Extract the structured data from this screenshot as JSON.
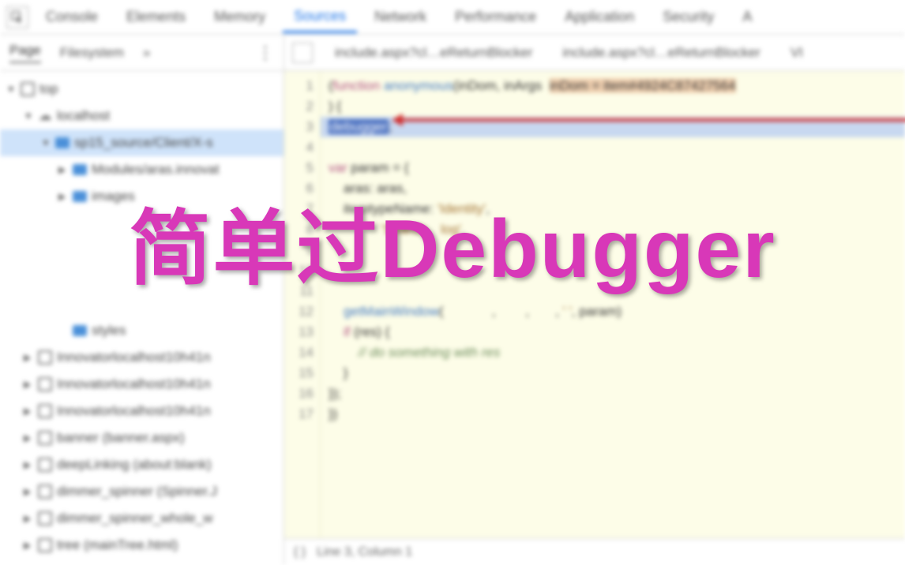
{
  "overlay": {
    "title": "简单过Debugger"
  },
  "toptabs": {
    "items": [
      "Console",
      "Elements",
      "Memory",
      "Sources",
      "Network",
      "Performance",
      "Application",
      "Security",
      "A"
    ],
    "active": 3
  },
  "sidebar": {
    "tabs": {
      "page": "Page",
      "fs": "Filesystem",
      "more": "»"
    },
    "tree": [
      {
        "d": 0,
        "arr": "▼",
        "ico": "frame",
        "txt": "top"
      },
      {
        "d": 1,
        "arr": "▼",
        "ico": "cloud",
        "txt": "localhost"
      },
      {
        "d": 2,
        "arr": "▼",
        "ico": "folder",
        "txt": "sp15_source/Client/X-s",
        "sel": true
      },
      {
        "d": 3,
        "arr": "▶",
        "ico": "folder",
        "txt": "Modules/aras.innovat"
      },
      {
        "d": 3,
        "arr": "▶",
        "ico": "folder",
        "txt": "images"
      },
      {
        "d": 3,
        "arr": "",
        "ico": "",
        "txt": ""
      },
      {
        "d": 3,
        "arr": "",
        "ico": "",
        "txt": ""
      },
      {
        "d": 3,
        "arr": "",
        "ico": "",
        "txt": ""
      },
      {
        "d": 3,
        "arr": "",
        "ico": "",
        "txt": ""
      },
      {
        "d": 3,
        "arr": "",
        "ico": "folder",
        "txt": "styles"
      },
      {
        "d": 1,
        "arr": "▶",
        "ico": "frame",
        "txt": "Innovatorlocalhost10h41n"
      },
      {
        "d": 1,
        "arr": "▶",
        "ico": "frame",
        "txt": "Innovatorlocalhost10h41n"
      },
      {
        "d": 1,
        "arr": "▶",
        "ico": "frame",
        "txt": "Innovatorlocalhost10h41n"
      },
      {
        "d": 1,
        "arr": "▶",
        "ico": "frame",
        "txt": "banner (banner.aspx)"
      },
      {
        "d": 1,
        "arr": "▶",
        "ico": "frame",
        "txt": "deepLinking (about:blank)"
      },
      {
        "d": 1,
        "arr": "▶",
        "ico": "frame",
        "txt": "dimmer_spinner (Spinner.J"
      },
      {
        "d": 1,
        "arr": "▶",
        "ico": "frame",
        "txt": "dimmer_spinner_whole_w"
      },
      {
        "d": 1,
        "arr": "▶",
        "ico": "frame",
        "txt": "tree (mainTree.html)"
      }
    ]
  },
  "editor": {
    "tabs": [
      "include.aspx?cl…eReturnBlocker",
      "include.aspx?cl…eReturnBlocker",
      "VI"
    ],
    "lines": [
      {
        "n": 1,
        "html": "(<span class='kw'>function</span> <span class='fn'>anonymous</span>(inDom, inArgs  <span style='background:#f0d0b0'>inDom = item#4924C87427564</span>"
      },
      {
        "n": 2,
        "html": ") {"
      },
      {
        "n": 3,
        "html": "<span class='dbg'>debugger</span>;",
        "hl": true
      },
      {
        "n": 4,
        "html": ""
      },
      {
        "n": 5,
        "html": "<span class='kw'>var</span> param = {"
      },
      {
        "n": 6,
        "html": "    aras: aras,"
      },
      {
        "n": 7,
        "html": "    itemtypeName: <span class='str'>'Identity'</span>,"
      },
      {
        "n": 8,
        "html": "              <span class='str'>'Search&nbsp;&nbsp;&nbsp;&nbsp;log'</span>,"
      },
      {
        "n": 9,
        "html": ""
      },
      {
        "n": 10,
        "html": ""
      },
      {
        "n": 11,
        "html": ""
      },
      {
        "n": 12,
        "html": "    <span class='fn'>getMainWindow</span>(             ,        ,       , <span class='str'>' '</span>, param)"
      },
      {
        "n": 13,
        "html": "    <span class='kw'>if</span> (res) {"
      },
      {
        "n": 14,
        "html": "        <span class='cm'>// do something with res</span>"
      },
      {
        "n": 15,
        "html": "    }"
      },
      {
        "n": 16,
        "html": "});"
      },
      {
        "n": 17,
        "html": "})"
      }
    ]
  },
  "status": {
    "pos": "Line 3, Column 1"
  }
}
